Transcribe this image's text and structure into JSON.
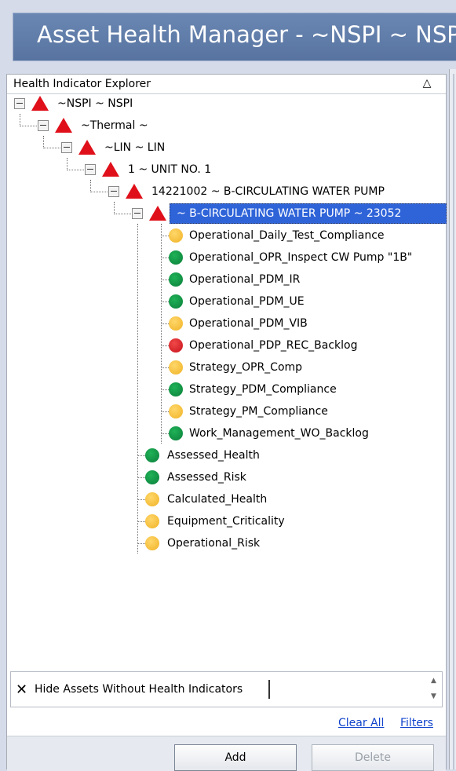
{
  "window": {
    "title": "Asset Health Manager -  ~NSPI ~ NSPI"
  },
  "explorer": {
    "header": "Health Indicator Explorer",
    "collapse_glyph": "△",
    "tree": {
      "n0": "~NSPI ~ NSPI",
      "n1": "~Thermal ~",
      "n2": "~LIN ~ LIN",
      "n3": "1 ~ UNIT NO. 1",
      "n4": "14221002 ~ B-CIRCULATING WATER PUMP",
      "n5": "~ B-CIRCULATING WATER PUMP ~ 23052",
      "indicators": [
        {
          "label": "Operational_Daily_Test_Compliance",
          "status": "yellow"
        },
        {
          "label": "Operational_OPR_Inspect CW Pump \"1B\"",
          "status": "green"
        },
        {
          "label": "Operational_PDM_IR",
          "status": "green"
        },
        {
          "label": "Operational_PDM_UE",
          "status": "green"
        },
        {
          "label": "Operational_PDM_VIB",
          "status": "yellow"
        },
        {
          "label": "Operational_PDP_REC_Backlog",
          "status": "red"
        },
        {
          "label": "Strategy_OPR_Comp",
          "status": "yellow"
        },
        {
          "label": "Strategy_PDM_Compliance",
          "status": "green"
        },
        {
          "label": "Strategy_PM_Compliance",
          "status": "yellow"
        },
        {
          "label": "Work_Management_WO_Backlog",
          "status": "green"
        }
      ],
      "asset_indicators": [
        {
          "label": "Assessed_Health",
          "status": "green"
        },
        {
          "label": "Assessed_Risk",
          "status": "green"
        },
        {
          "label": "Calculated_Health",
          "status": "yellow"
        },
        {
          "label": "Equipment_Criticality",
          "status": "yellow"
        },
        {
          "label": "Operational_Risk",
          "status": "yellow"
        }
      ]
    },
    "filter": {
      "text": "Hide Assets Without Health Indicators"
    },
    "links": {
      "clear_all": "Clear All",
      "filters": "Filters"
    },
    "buttons": {
      "add": "Add",
      "delete": "Delete"
    }
  },
  "colors": {
    "title_bar": "#5f7ba8",
    "selection": "#2f64d9",
    "alert_red": "#e0101a",
    "status_green": "#0b7f3a",
    "status_yellow": "#f0b225",
    "status_red": "#c8131c",
    "link_blue": "#1144cc"
  }
}
